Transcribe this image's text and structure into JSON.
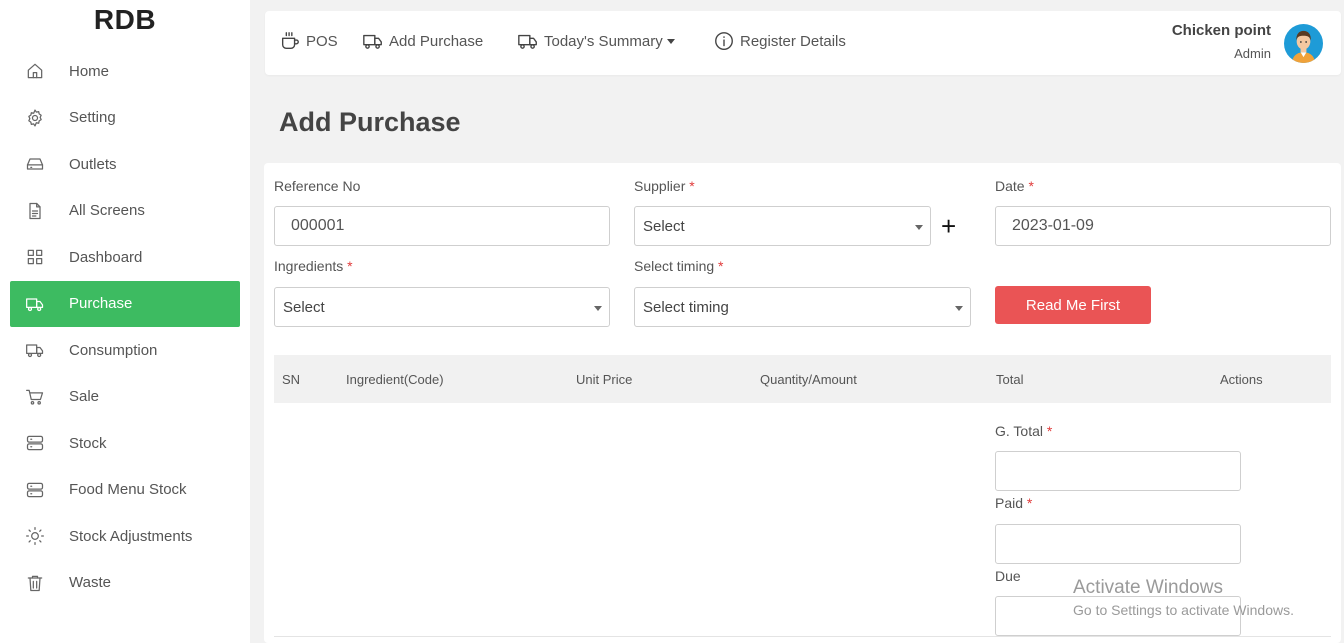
{
  "app": {
    "brand": "RDB"
  },
  "sidebar": {
    "items": [
      {
        "label": "Home",
        "icon": "home-icon"
      },
      {
        "label": "Setting",
        "icon": "gear-icon"
      },
      {
        "label": "Outlets",
        "icon": "drive-icon"
      },
      {
        "label": "All Screens",
        "icon": "document-icon"
      },
      {
        "label": "Dashboard",
        "icon": "grid-icon"
      },
      {
        "label": "Purchase",
        "icon": "truck-icon",
        "active": true
      },
      {
        "label": "Consumption",
        "icon": "truck-icon"
      },
      {
        "label": "Sale",
        "icon": "cart-icon"
      },
      {
        "label": "Stock",
        "icon": "server-icon"
      },
      {
        "label": "Food Menu Stock",
        "icon": "server-icon"
      },
      {
        "label": "Stock Adjustments",
        "icon": "sun-icon"
      },
      {
        "label": "Waste",
        "icon": "trash-icon"
      }
    ]
  },
  "topbar": {
    "pos": "POS",
    "add_purchase": "Add Purchase",
    "todays_summary": "Today's Summary",
    "register_details": "Register Details",
    "user_name": "Chicken point",
    "user_role": "Admin"
  },
  "page": {
    "title": "Add Purchase"
  },
  "form": {
    "reference_label": "Reference No",
    "reference_value": "000001",
    "supplier_label": "Supplier",
    "supplier_value": "Select",
    "date_label": "Date",
    "date_value": "2023-01-09",
    "ingredients_label": "Ingredients",
    "ingredients_value": "Select",
    "timing_label": "Select timing",
    "timing_value": "Select timing",
    "read_me_button": "Read Me First",
    "required_mark": "*",
    "add_supplier": "+"
  },
  "table": {
    "headers": [
      "SN",
      "Ingredient(Code)",
      "Unit Price",
      "Quantity/Amount",
      "Total",
      "Actions"
    ]
  },
  "totals": {
    "grand_total_label": "G. Total",
    "paid_label": "Paid",
    "due_label": "Due",
    "grand_total_value": "",
    "paid_value": "",
    "due_value": ""
  },
  "watermark": {
    "line1": "Activate Windows",
    "line2": "Go to Settings to activate Windows."
  },
  "colors": {
    "active": "#3dbb61",
    "danger": "#ea5455",
    "required": "#e03b3b"
  }
}
